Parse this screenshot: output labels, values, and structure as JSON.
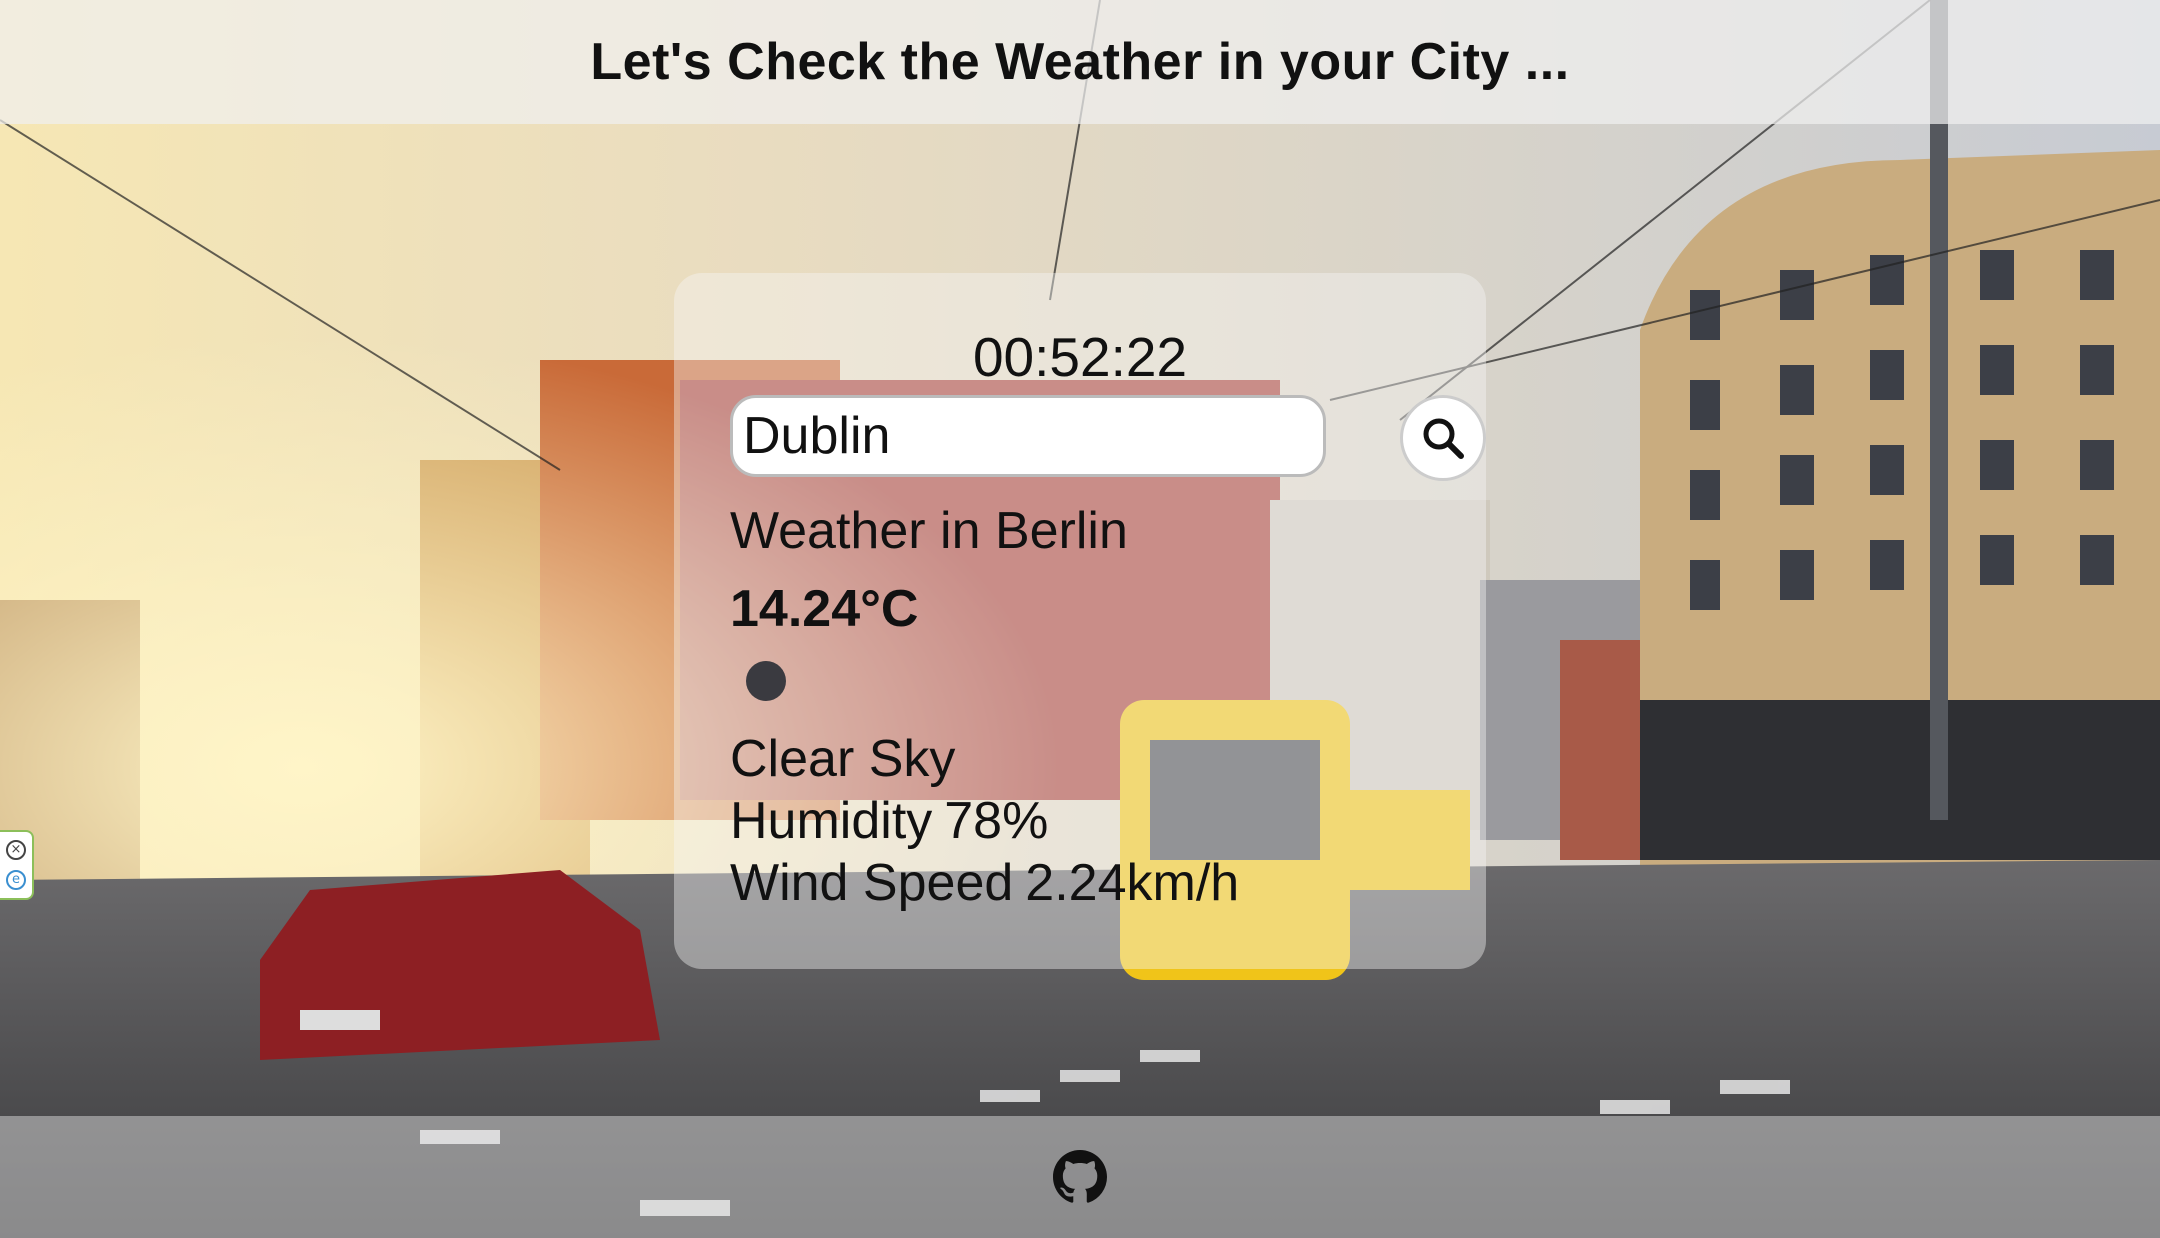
{
  "header": {
    "title": "Let's Check the Weather in your City ..."
  },
  "widget": {
    "time": "00:52:22",
    "search": {
      "value": "Dublin",
      "button_icon": "search-icon"
    },
    "city_heading": "Weather in Berlin",
    "temperature": "14.24°C",
    "weather_icon": "clear-sky-icon",
    "description": "Clear Sky",
    "humidity_label": "Humidity",
    "humidity_value": "78%",
    "wind_label": "Wind Speed",
    "wind_value": "2.24km/h"
  },
  "footer": {
    "icon": "github-icon"
  },
  "side_badges": [
    "close-icon",
    "extension-icon"
  ],
  "colors": {
    "header_bg": "#f0f0f0",
    "card_bg": "#f5f5f5",
    "text": "#111111",
    "side_badge_border": "#8cbf5a"
  }
}
